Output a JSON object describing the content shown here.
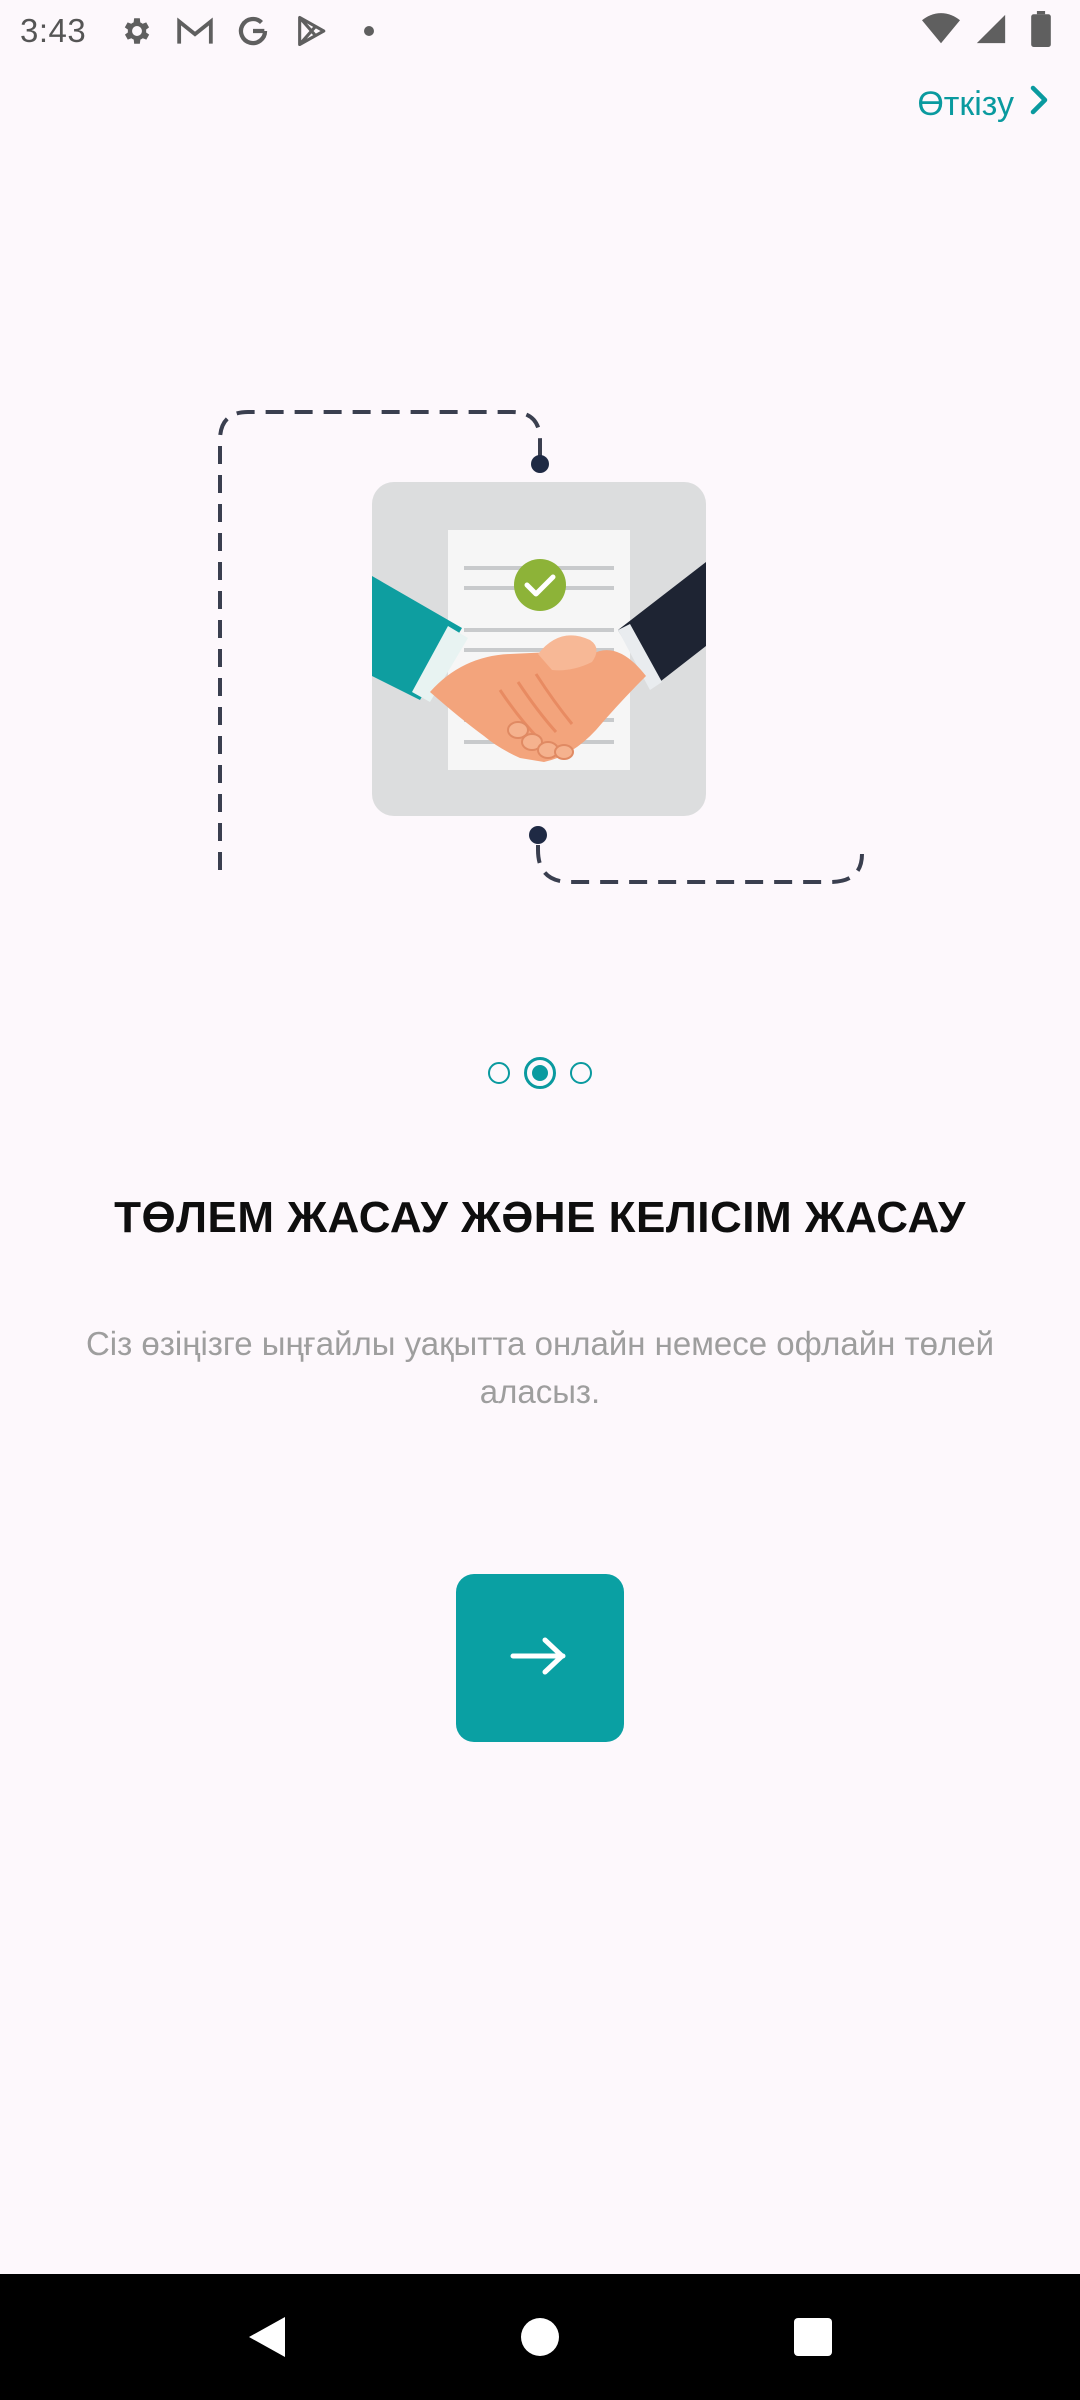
{
  "status_bar": {
    "time": "3:43",
    "left_icons": [
      "settings-icon",
      "gmail-icon",
      "google-icon",
      "play-store-icon",
      "dot-icon"
    ],
    "right_icons": [
      "wifi-icon",
      "signal-icon",
      "battery-icon"
    ]
  },
  "skip": {
    "label": "Өткізу",
    "icon": "chevron-right-icon"
  },
  "illustration": {
    "subject": "handshake-contract-icon"
  },
  "pager": {
    "total": 3,
    "active_index": 1
  },
  "title": "ТӨЛЕМ ЖАСАУ ЖӘНЕ КЕЛІСІМ ЖАСАУ",
  "description": "Сіз өзіңізге ыңғайлы уақытта онлайн немесе офлайн төлей аласыз.",
  "next_button": {
    "icon": "arrow-right-icon"
  },
  "colors": {
    "accent": "#0AA0A3",
    "background": "#FDF8FC",
    "title": "#0E0E0E",
    "description": "#9E9E9E"
  },
  "nav_bar": {
    "buttons": [
      "back-icon",
      "home-icon",
      "recents-icon"
    ]
  }
}
